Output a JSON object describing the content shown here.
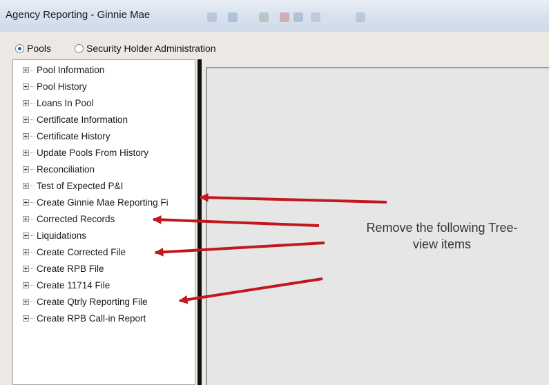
{
  "window": {
    "title": "Agency Reporting - Ginnie Mae"
  },
  "mode_options": [
    {
      "label": "Pools",
      "selected": true
    },
    {
      "label": "Security Holder Administration",
      "selected": false
    }
  ],
  "tree_items": [
    "Pool Information",
    "Pool History",
    "Loans In Pool",
    "Certificate Information",
    "Certificate History",
    "Update Pools From History",
    "Reconciliation",
    "Test of Expected P&I",
    "Create Ginnie Mae Reporting Fi",
    "Corrected Records",
    "Liquidations",
    "Create Corrected File",
    "Create RPB File",
    "Create 11714 File",
    "Create Qtrly Reporting File",
    "Create RPB Call-in Report"
  ],
  "annotation": {
    "line1": "Remove the following Tree-",
    "line2": "view items",
    "color": "#c0181c"
  }
}
